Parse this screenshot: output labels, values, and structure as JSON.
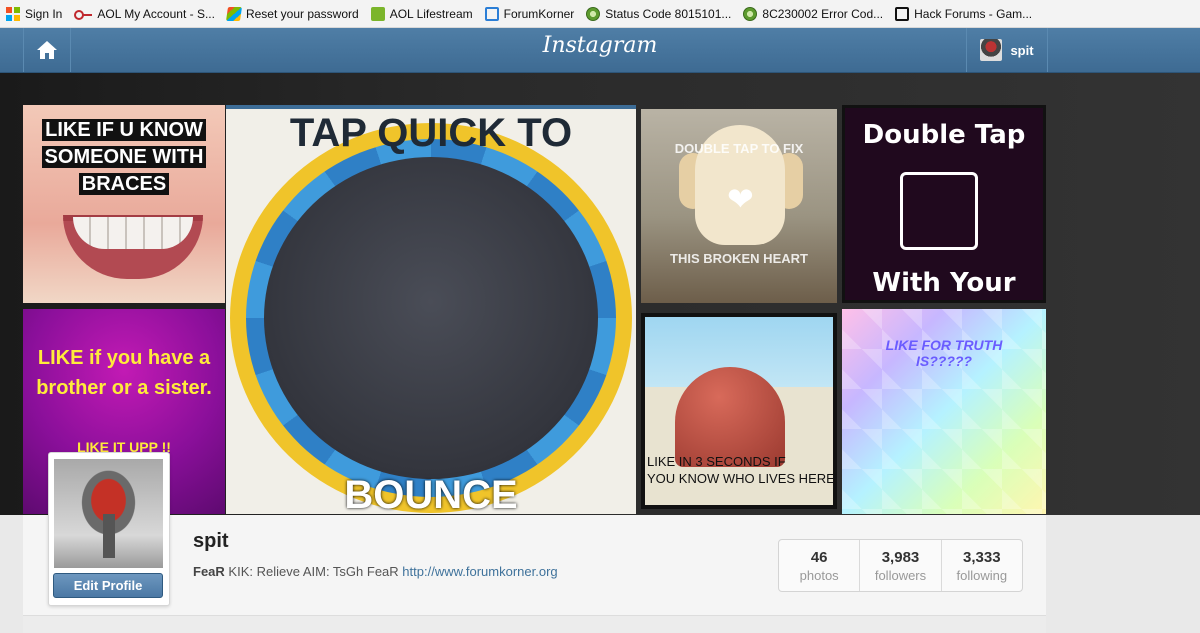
{
  "bookmarks": [
    {
      "label": "Sign In",
      "icon": "microsoft-icon"
    },
    {
      "label": "AOL My Account - S...",
      "icon": "key-icon"
    },
    {
      "label": "Reset your password",
      "icon": "windows-icon"
    },
    {
      "label": "AOL Lifestream",
      "icon": "aol-icon"
    },
    {
      "label": "ForumKorner",
      "icon": "forumkorner-icon"
    },
    {
      "label": "Status Code 8015101...",
      "icon": "xbox-icon"
    },
    {
      "label": "8C230002 Error Cod...",
      "icon": "xbox-icon"
    },
    {
      "label": "Hack Forums - Gam...",
      "icon": "hackforums-icon"
    }
  ],
  "header": {
    "logo": "Instagram",
    "username": "spit",
    "bar_color": "#4a7aa2"
  },
  "grid": {
    "tile1": {
      "lines": [
        "LIKE IF U KNOW",
        "SOMEONE WITH",
        "BRACES"
      ]
    },
    "tile2": {
      "top": "TAP QUICK TO",
      "bottom": "BOUNCE"
    },
    "tile3": {
      "line1": "DOUBLE TAP TO FIX",
      "line2": "THIS BROKEN HEART"
    },
    "tile4": {
      "line1": "Double Tap",
      "line2": "With Your Elbow"
    },
    "tile5": {
      "line1": "LIKE if  you have a",
      "line2": "brother or a sister.",
      "line3": "LIKE IT UPP !!"
    },
    "tile6": {
      "line1": "LIKE IN 3 SECONDS IF",
      "line2": "YOU KNOW  WHO LIVES HERE"
    },
    "tile7": {
      "line1": "LIKE FOR TRUTH",
      "line2": "IS?????"
    }
  },
  "profile": {
    "username": "spit",
    "bio_name": "FeaR",
    "bio_text": " KIK: Relieve AIM: TsGh FeaR ",
    "bio_link": "http://www.forumkorner.org",
    "edit_label": "Edit Profile",
    "stats": [
      {
        "value": "46",
        "label": "photos"
      },
      {
        "value": "3,983",
        "label": "followers"
      },
      {
        "value": "3,333",
        "label": "following"
      }
    ]
  }
}
